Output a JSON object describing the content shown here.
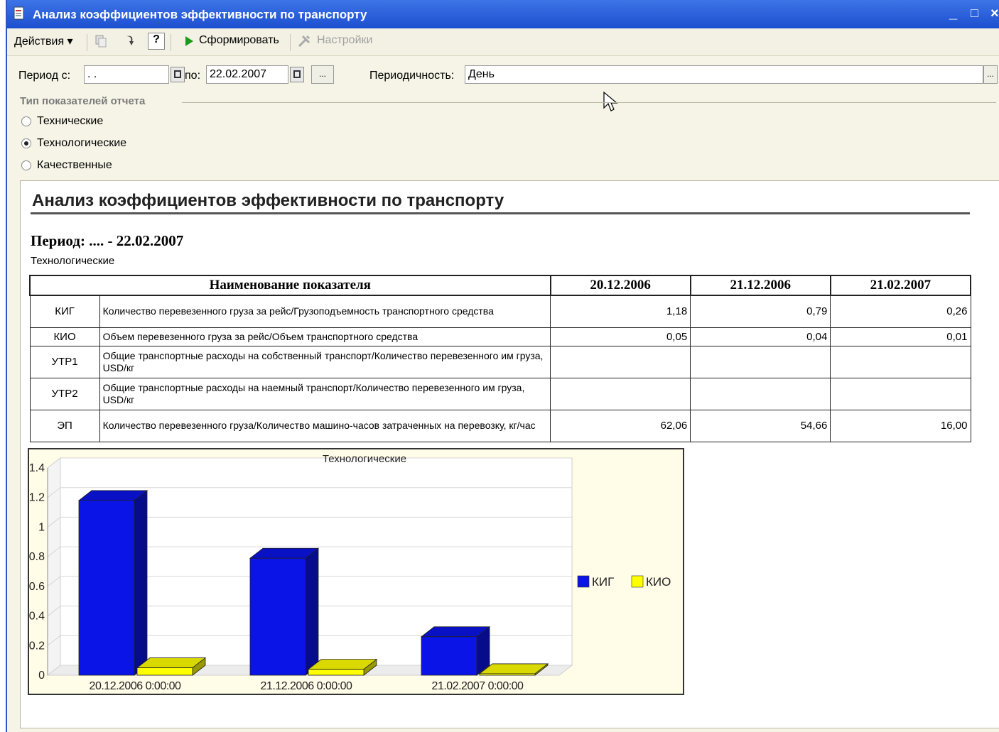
{
  "window": {
    "title": "Анализ коэффициентов эффективности по транспорту",
    "controls": {
      "minimize": "_",
      "maximize": "□",
      "close": "×"
    }
  },
  "toolbar": {
    "actions_label": "Действия ▾",
    "generate_label": "Сформировать",
    "settings_label": "Настройки",
    "help_label": "?"
  },
  "params": {
    "period_from_label": "Период с:",
    "period_from_value": ". .",
    "period_to_label": "по:",
    "period_to_value": "22.02.2007",
    "ellipsis": "...",
    "periodicity_label": "Периодичность:",
    "periodicity_value": "День",
    "group_title": "Тип показателей отчета",
    "radio_options": [
      {
        "label": "Технические",
        "selected": false
      },
      {
        "label": "Технологические",
        "selected": true
      },
      {
        "label": "Качественные",
        "selected": false
      }
    ]
  },
  "report": {
    "title": "Анализ коэффициентов эффективности по транспорту",
    "period": "Период: .... - 22.02.2007",
    "type": "Технологические",
    "table": {
      "headers": [
        "Наименование показателя",
        "20.12.2006",
        "21.12.2006",
        "21.02.2007"
      ],
      "rows": [
        {
          "code": "КИГ",
          "name": "Количество перевезенного груза за рейс/Грузоподъемность транспортного средства",
          "values": [
            "1,18",
            "0,79",
            "0,26"
          ]
        },
        {
          "code": "КИО",
          "name": "Объем перевезенного груза за рейс/Объем транспортного средства",
          "values": [
            "0,05",
            "0,04",
            "0,01"
          ]
        },
        {
          "code": "УТР1",
          "name": "Общие транспортные расходы на собственный транспорт/Количество перевезенного им груза, USD/кг",
          "values": [
            "",
            "",
            ""
          ]
        },
        {
          "code": "УТР2",
          "name": "Общие транспортные расходы на наемный транспорт/Количество перевезенного им груза, USD/кг",
          "values": [
            "",
            "",
            ""
          ]
        },
        {
          "code": "ЭП",
          "name": "Количество перевезенного груза/Количество машино-часов затраченных на перевозку, кг/час",
          "values": [
            "62,06",
            "54,66",
            "16,00"
          ]
        }
      ]
    }
  },
  "chart_data": {
    "type": "bar",
    "title": "Технологические",
    "categories": [
      "20.12.2006 0:00:00",
      "21.12.2006 0:00:00",
      "21.02.2007 0:00:00"
    ],
    "series": [
      {
        "name": "КИГ",
        "values": [
          1.18,
          0.79,
          0.26
        ],
        "color": "#0a14e6"
      },
      {
        "name": "КИО",
        "values": [
          0.05,
          0.04,
          0.01
        ],
        "color": "#ffff00"
      }
    ],
    "ylim": [
      0,
      1.4
    ],
    "yticks": [
      "0",
      "0.2",
      "0.4",
      "0.6",
      "0.8",
      "1",
      "1.2",
      "1.4"
    ],
    "grid": true,
    "legend_position": "right",
    "style": "3d"
  }
}
